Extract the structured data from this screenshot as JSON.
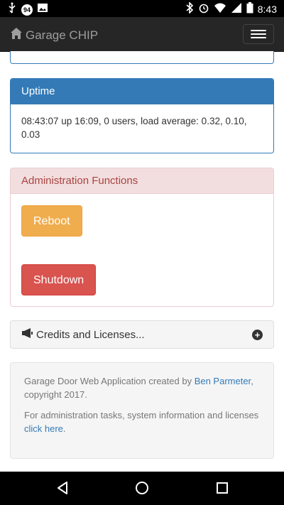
{
  "status_bar": {
    "badge": "94",
    "time": "8:43",
    "icons": [
      "usb-icon",
      "notification-badge-icon",
      "image-icon",
      "bluetooth-icon",
      "alarm-icon",
      "wifi-icon",
      "signal-icon",
      "battery-icon"
    ]
  },
  "navbar": {
    "brand": "Garage CHIP",
    "brand_icon": "home-icon",
    "menu_icon": "hamburger-icon"
  },
  "uptime": {
    "title": "Uptime",
    "text": "08:43:07 up 16:09, 0 users, load average: 0.32, 0.10, 0.03"
  },
  "admin": {
    "title": "Administration Functions",
    "reboot_label": "Reboot",
    "shutdown_label": "Shutdown"
  },
  "credits": {
    "title": "Credits and Licenses...",
    "icon": "megaphone-icon",
    "expand_icon": "plus-circle-icon"
  },
  "footer": {
    "line1_prefix": "Garage Door Web Application created by ",
    "line1_link": "Ben Parmeter",
    "line1_suffix": ", copyright 2017.",
    "line2_prefix": "For administration tasks, system information and licenses ",
    "line2_link": "click here",
    "line2_suffix": "."
  },
  "colors": {
    "primary": "#337ab7",
    "danger_heading": "#f2dede",
    "warning_button": "#f0ad4e",
    "danger_button": "#d9534f",
    "navbar": "#262626"
  }
}
